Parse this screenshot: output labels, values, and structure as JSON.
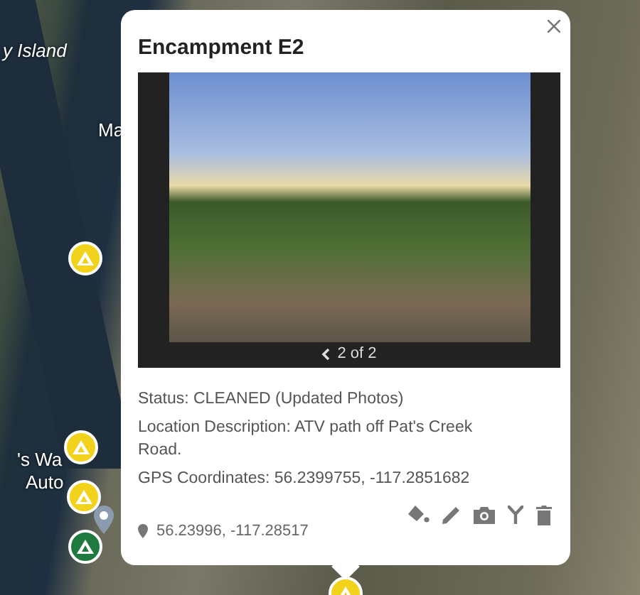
{
  "map": {
    "labels": [
      {
        "text": "y Island",
        "kind": "italic"
      },
      {
        "text": "Ma",
        "kind": "plain"
      },
      {
        "text": "'s Wa",
        "kind": "plain"
      },
      {
        "text": "Auto",
        "kind": "plain"
      }
    ],
    "markers": [
      {
        "kind": "tent",
        "color": "#f2d21b"
      },
      {
        "kind": "tent",
        "color": "#f2d21b"
      },
      {
        "kind": "tent",
        "color": "#f2d21b"
      },
      {
        "kind": "tent",
        "color": "#1f7a40"
      },
      {
        "kind": "pin",
        "color": "#8a9bb0"
      }
    ]
  },
  "popup": {
    "title": "Encampment E2",
    "gallery": {
      "caption": "2 of 2"
    },
    "details": [
      "Status: CLEANED (Updated Photos)",
      "Location Description: ATV path off Pat's Creek Road.",
      "GPS Coordinates: 56.2399755, -117.2851682"
    ],
    "location": "56.23996, -117.28517"
  }
}
